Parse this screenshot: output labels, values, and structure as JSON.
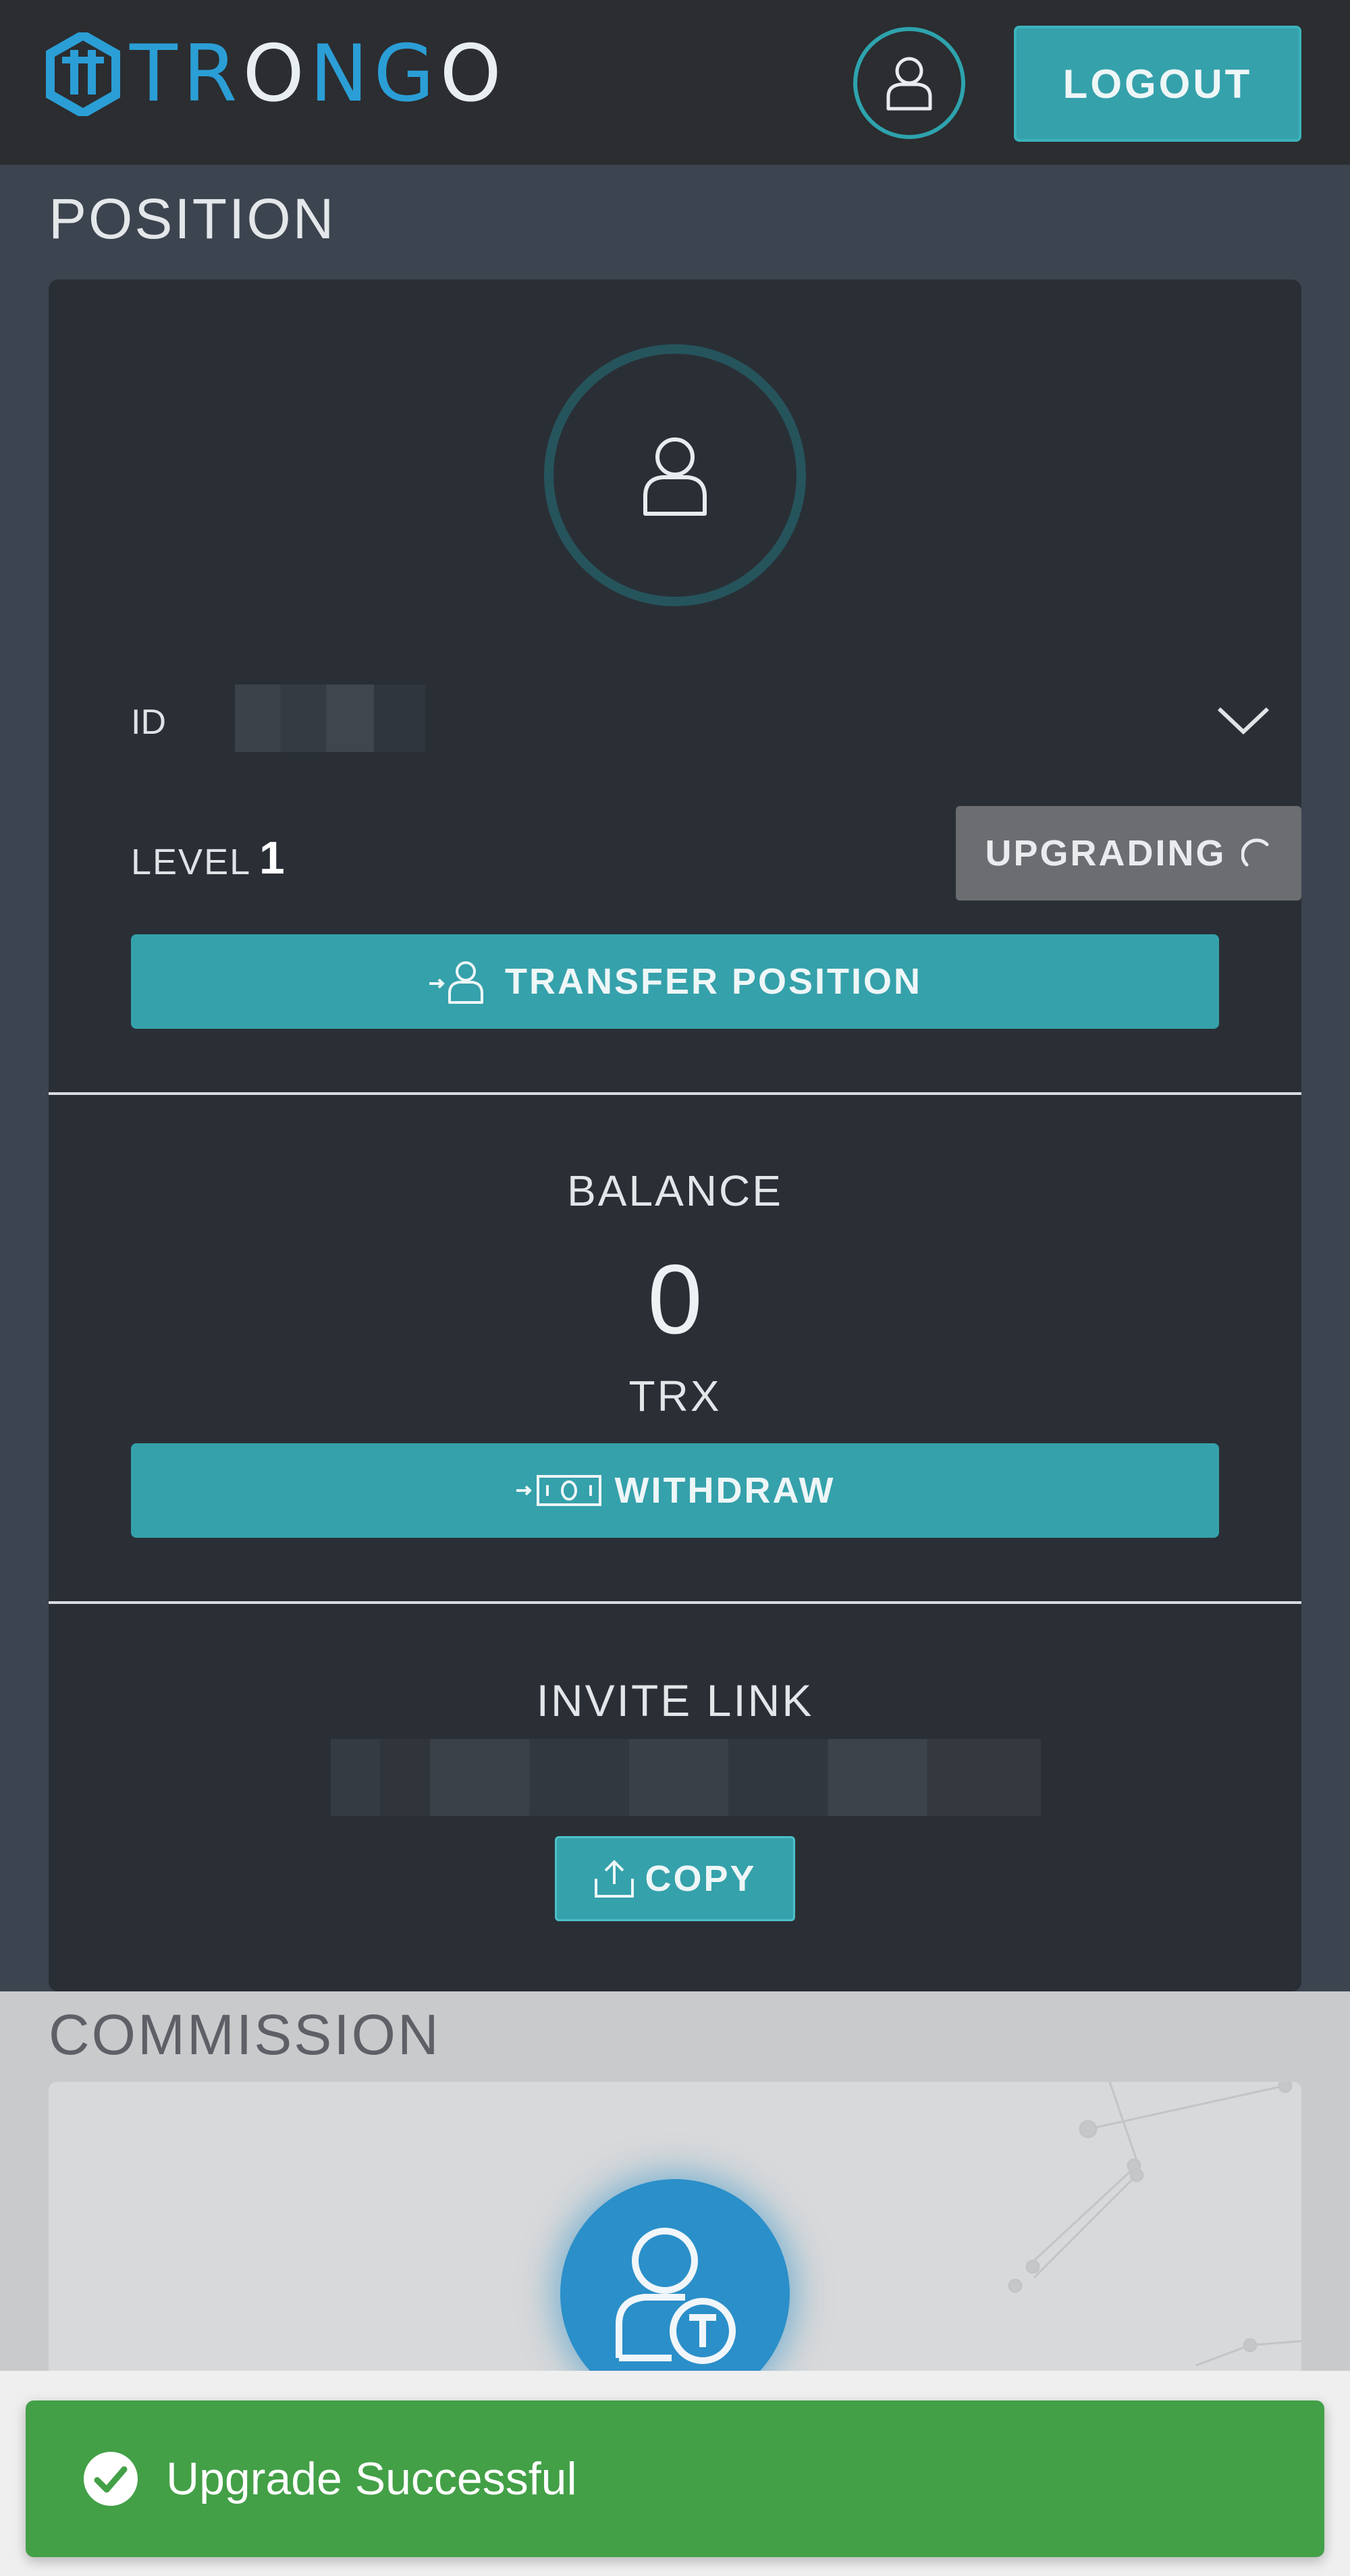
{
  "header": {
    "logo_text_parts": [
      "TR",
      "O",
      "NG",
      "O"
    ],
    "logout_label": "LOGOUT"
  },
  "position": {
    "title": "POSITION",
    "id_label": "ID",
    "id_value": "",
    "level_label": "LEVEL",
    "level_value": "1",
    "upgrade_label": "UPGRADING",
    "transfer_label": "TRANSFER POSITION",
    "balance_label": "BALANCE",
    "balance_value": "0",
    "balance_unit": "TRX",
    "withdraw_label": "WITHDRAW",
    "invite_label": "INVITE LINK",
    "invite_value": "",
    "copy_label": "COPY"
  },
  "commission": {
    "title": "COMMISSION"
  },
  "toast": {
    "message": "Upgrade Successful",
    "color": "#43a047"
  },
  "colors": {
    "accent": "#35a1ab",
    "brand": "#2b9ed6",
    "upgrading_button": "#6b6d70"
  },
  "icons": {
    "logo": "trongo-logo-icon",
    "avatar": "user-icon",
    "dropdown": "chevron-down-icon",
    "transfer": "user-transfer-icon",
    "withdraw": "money-withdraw-icon",
    "copy": "upload-share-icon",
    "commission": "user-token-icon",
    "toast": "check-circle-icon"
  }
}
